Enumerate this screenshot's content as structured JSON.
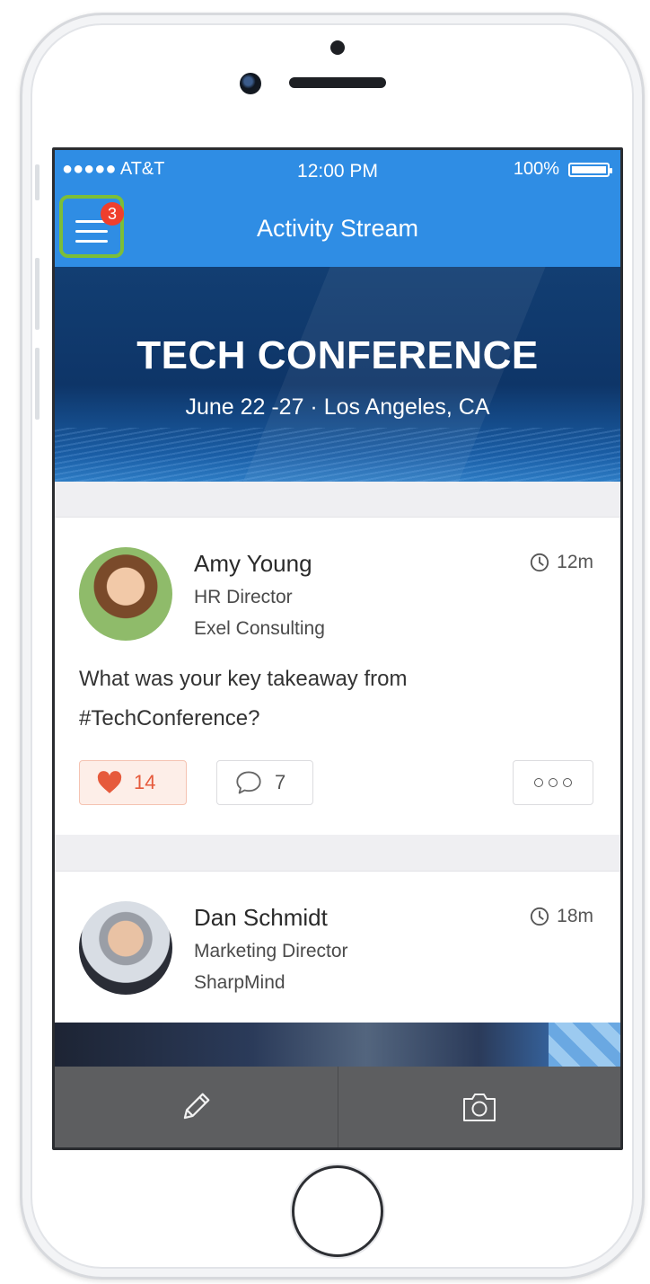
{
  "status_bar": {
    "carrier": "●●●●● AT&T",
    "time": "12:00 PM",
    "battery": "100%"
  },
  "nav": {
    "title": "Activity Stream",
    "menu_icon": "hamburger-menu-icon",
    "badge_count": "3"
  },
  "banner": {
    "title": "TECH CONFERENCE",
    "subtitle": "June 22 -27  ·  Los Angeles, CA"
  },
  "posts": [
    {
      "name": "Amy Young",
      "role": "HR Director",
      "company": "Exel Consulting",
      "time": "12m",
      "text": "What was your key takeaway from #TechConference?",
      "likes": "14",
      "comments": "7"
    },
    {
      "name": "Dan Schmidt",
      "role": "Marketing Director",
      "company": "SharpMind",
      "time": "18m"
    }
  ],
  "tab_bar": {
    "items": [
      {
        "icon": "pencil-icon"
      },
      {
        "icon": "camera-icon"
      }
    ]
  },
  "colors": {
    "accent": "#2f8de4",
    "badge": "#ef3f2d",
    "highlight": "#7cbe38",
    "like": "#e65a3c",
    "tab_bar": "#5d5e60"
  }
}
